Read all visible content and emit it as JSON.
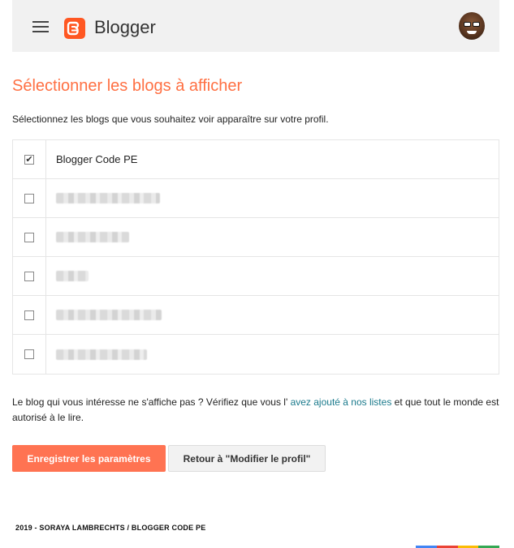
{
  "header": {
    "app_name": "Blogger",
    "menu_icon": "hamburger-menu-icon",
    "logo_icon": "blogger-logo-icon",
    "avatar_icon": "user-avatar-icon",
    "bg_color": "#f1f1f1",
    "logo_color": "#ff5722"
  },
  "page": {
    "title": "Sélectionner les blogs à afficher",
    "intro": "Sélectionnez les blogs que vous souhaitez voir apparaître sur votre profil.",
    "title_color": "#ff7043"
  },
  "blogs": [
    {
      "name": "Blogger Code PE",
      "checked": true,
      "redacted": false
    },
    {
      "name": "",
      "checked": false,
      "redacted": true
    },
    {
      "name": "",
      "checked": false,
      "redacted": true
    },
    {
      "name": "",
      "checked": false,
      "redacted": true
    },
    {
      "name": "",
      "checked": false,
      "redacted": true
    },
    {
      "name": "",
      "checked": false,
      "redacted": true
    }
  ],
  "help": {
    "before": "Le blog qui vous intéresse ne s'affiche pas ? Vérifiez que vous l'",
    "link": "avez ajouté à nos listes",
    "after": "et que tout le monde est autorisé à le lire."
  },
  "actions": {
    "save_label": "Enregistrer les paramètres",
    "back_label": "Retour à \"Modifier le profil\"",
    "save_color": "#ff7352"
  },
  "footer": {
    "text": "2019 - SORAYA LAMBRECHTS / BLOGGER CODE PE",
    "colors": [
      "#4285f4",
      "#ea4335",
      "#fbbc05",
      "#34a853"
    ]
  }
}
